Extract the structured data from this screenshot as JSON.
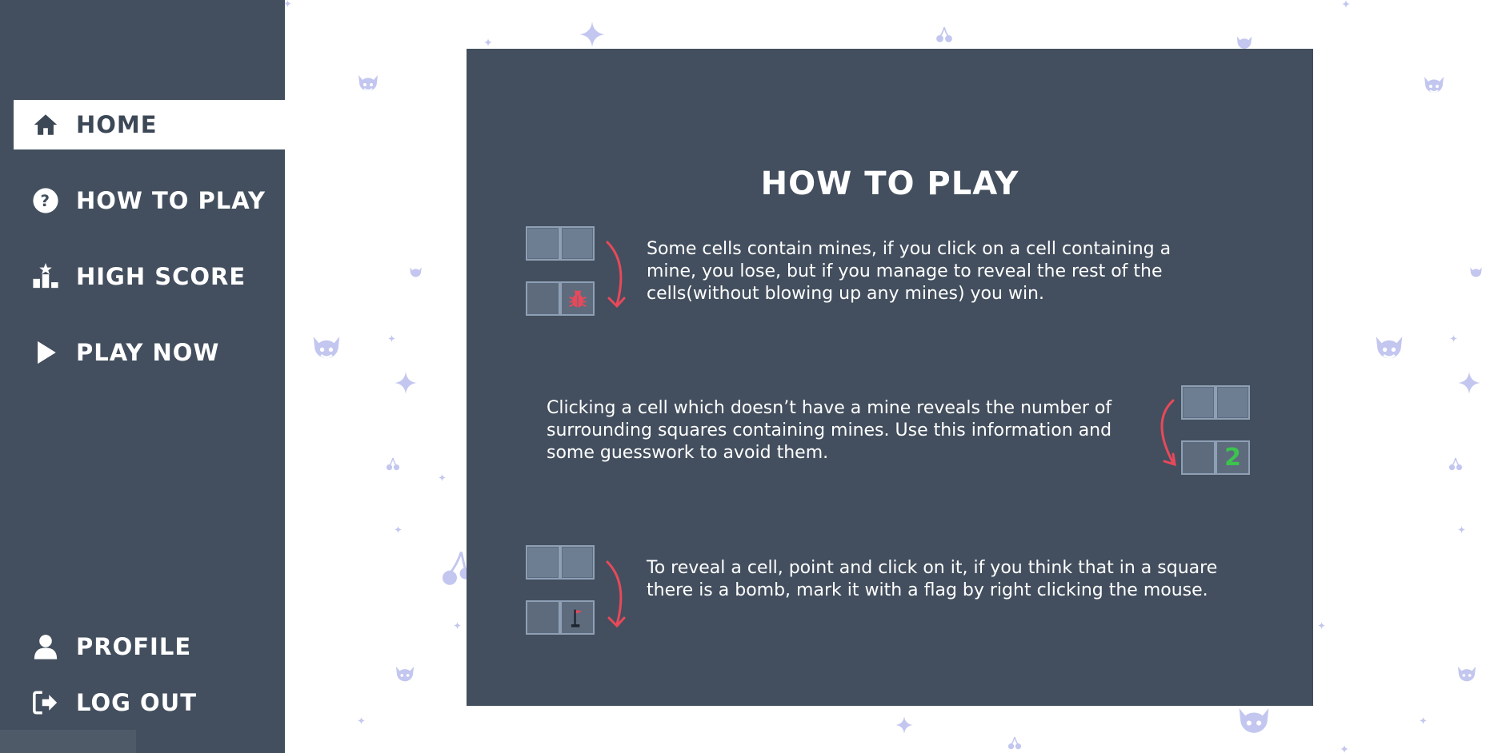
{
  "sidebar": {
    "items": [
      {
        "label": "HOME",
        "icon": "home-icon",
        "active": true
      },
      {
        "label": "HOW TO PLAY",
        "icon": "question-circle-icon",
        "active": false
      },
      {
        "label": "HIGH SCORE",
        "icon": "podium-icon",
        "active": false
      },
      {
        "label": "PLAY NOW",
        "icon": "play-icon",
        "active": false
      }
    ],
    "bottom_items": [
      {
        "label": "PROFILE",
        "icon": "user-icon"
      },
      {
        "label": "LOG OUT",
        "icon": "logout-icon"
      }
    ]
  },
  "main": {
    "title": "HOW TO PLAY",
    "rules": [
      {
        "text": "Some cells contain mines, if you click on a cell containing a mine, you lose, but if you manage to reveal the rest of the cells(without blowing up any mines) you win.",
        "illustration": "bug-icon"
      },
      {
        "text": "Clicking a cell which doesn’t have a mine reveals the number of surrounding squares containing mines. Use this information and some guesswork to avoid them.",
        "illustration": "number",
        "number": "2"
      },
      {
        "text": "To reveal a cell, point and click on it, if you think that in a square there is a bomb, mark it with a flag by right clicking the mouse.",
        "illustration": "flag-icon"
      }
    ]
  },
  "colors": {
    "sidebar_bg": "#434f5e",
    "card_bg": "#434f5e",
    "arrow": "#e8495a",
    "number": "#3cc44e",
    "decoration": "#c3c6ef"
  }
}
